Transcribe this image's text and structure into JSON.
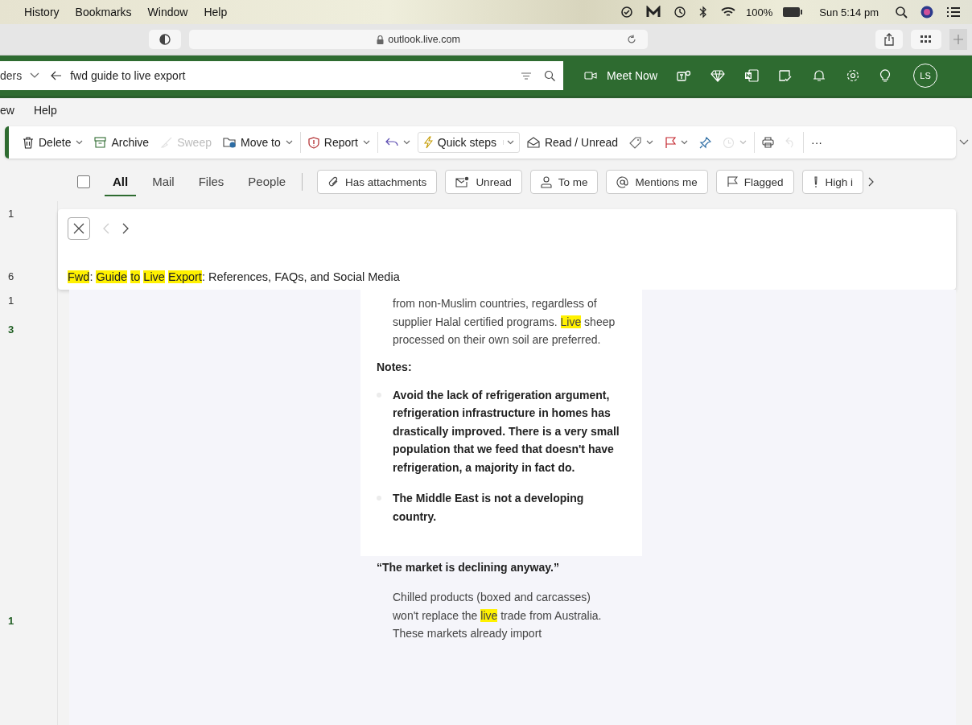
{
  "menubar": {
    "items": [
      "History",
      "Bookmarks",
      "Window",
      "Help"
    ],
    "battery": "100%",
    "clock": "Sun 5:14 pm"
  },
  "browser": {
    "url": "outlook.live.com"
  },
  "header": {
    "folders": "ders",
    "search_query": "fwd guide to live export",
    "meet_now": "Meet Now",
    "avatar": "LS"
  },
  "menu_tabs": [
    "ew",
    "Help"
  ],
  "ribbon": [
    {
      "label": "Delete",
      "dropdown": true,
      "disabled": false
    },
    {
      "label": "Archive",
      "dropdown": false,
      "disabled": false
    },
    {
      "label": "Sweep",
      "dropdown": false,
      "disabled": true
    },
    {
      "label": "Move to",
      "dropdown": true,
      "disabled": false
    },
    {
      "label": "Report",
      "dropdown": true,
      "disabled": false
    },
    {
      "dropdown": true,
      "disabled": false
    },
    {
      "label": "Quick steps",
      "dropdown": true,
      "disabled": false
    },
    {
      "label": "Read / Unread",
      "dropdown": false,
      "disabled": false
    },
    {
      "dropdown": true,
      "disabled": false
    },
    {
      "dropdown": true,
      "disabled": false
    },
    {
      "dropdown": false,
      "disabled": false
    },
    {
      "dropdown": true,
      "disabled": true
    },
    {
      "dropdown": false,
      "disabled": false
    },
    {
      "dropdown": false,
      "disabled": true
    },
    {
      "label": "···",
      "dropdown": false,
      "disabled": false
    }
  ],
  "filters": {
    "checked": false,
    "tabs": [
      {
        "label": "All",
        "selected": true
      },
      {
        "label": "Mail",
        "selected": false
      },
      {
        "label": "Files",
        "selected": false
      },
      {
        "label": "People",
        "selected": false
      }
    ],
    "chips": [
      "Has attachments",
      "Unread",
      "To me",
      "Mentions me",
      "Flagged",
      "High i"
    ]
  },
  "folder_counts": [
    "1",
    "6",
    "1",
    "3",
    "1"
  ],
  "search_panel": {
    "previous_disabled": true,
    "subject": [
      {
        "text": "Fwd",
        "highlight": true
      },
      {
        "text": ": ",
        "highlight": false
      },
      {
        "text": "Guide ",
        "highlight": true
      },
      {
        "text": "to ",
        "highlight": true
      },
      {
        "text": "Live ",
        "highlight": true
      },
      {
        "text": "Export",
        "highlight": true
      },
      {
        "text": ": References, FAQs, and Social Media",
        "highlight": false
      }
    ]
  },
  "email": {
    "paragraph_1": [
      {
        "text": "from non-Muslim countries, regardless of supplier Halal certified programs.  ",
        "highlight": false
      },
      {
        "text": "Live",
        "highlight": true
      },
      {
        "text": " sheep processed on their own soil are preferred.",
        "highlight": false
      }
    ],
    "notes_heading": "Notes:",
    "notes": [
      "Avoid the lack of refrigeration argument, refrigeration infrastructure in homes has drastically improved.  There is a very small population that we feed that doesn't have refrigeration, a majority in fact do.",
      "The Middle East is not a developing country."
    ],
    "quote_heading": "“The market is declining anyway.”",
    "paragraph_2": [
      {
        "text": "Chilled products (boxed and carcasses) won't replace the ",
        "highlight": false
      },
      {
        "text": "live",
        "highlight": true
      },
      {
        "text": " trade from Australia. These markets already import",
        "highlight": false
      }
    ]
  }
}
